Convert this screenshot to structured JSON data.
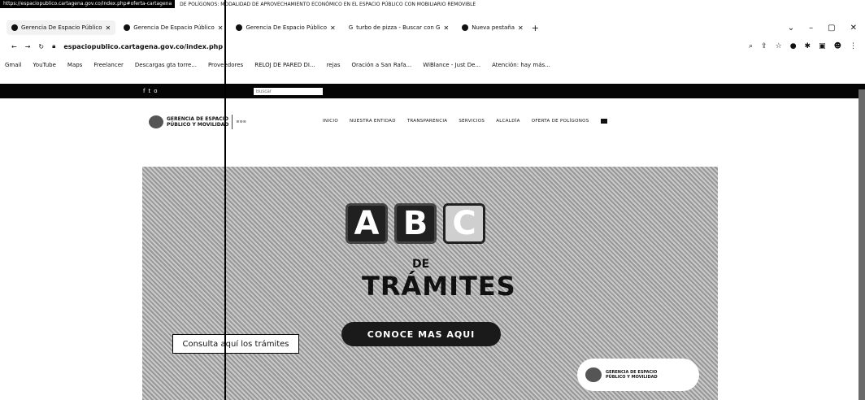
{
  "status": {
    "url": "https://espaciopublico.cartagena.gov.co/index.php#oferta-cartagena",
    "note": "DE POLÍGONOS: MODALIDAD DE APROVECHAMIENTO ECONÓMICO EN EL ESPACIO PÚBLICO CON MOBILIARIO REMOVIBLE"
  },
  "tabs": [
    {
      "label": "Gerencia De Espacio Público"
    },
    {
      "label": "Gerencia De Espacio Público"
    },
    {
      "label": "Gerencia De Espacio Público"
    },
    {
      "label": "turbo de pizza - Buscar con G"
    },
    {
      "label": "Nueva pestaña"
    }
  ],
  "address": {
    "url": "espaciopublico.cartagena.gov.co/index.php"
  },
  "bookmarks": [
    "Gmail",
    "YouTube",
    "Maps",
    "Freelancer",
    "Descargas gta torre...",
    "Proveedores",
    "RELOJ DE PARED DI...",
    "rejas",
    "Oración a San Rafa...",
    "WiBlance - Just De...",
    "Atención: hay más..."
  ],
  "topbar": {
    "search_placeholder": "Buscar"
  },
  "logo": {
    "line1": "GERENCIA DE ESPACIO",
    "line2": "PÚBLICO Y MOVILIDAD"
  },
  "menu": [
    "INICIO",
    "NUESTRA ENTIDAD",
    "TRANSPARENCIA",
    "SERVICIOS",
    "ALCALDÍA",
    "OFERTA DE POLÍGONOS"
  ],
  "hero": {
    "letters": [
      "A",
      "B",
      "C"
    ],
    "de": "DE",
    "tramites": "TRÁMITES",
    "cta": "CONOCE MAS AQUI",
    "consulta": "Consulta aquí los trámites"
  },
  "colors": {
    "topbar": "#050505",
    "cta_bg": "#1a1a1a"
  }
}
